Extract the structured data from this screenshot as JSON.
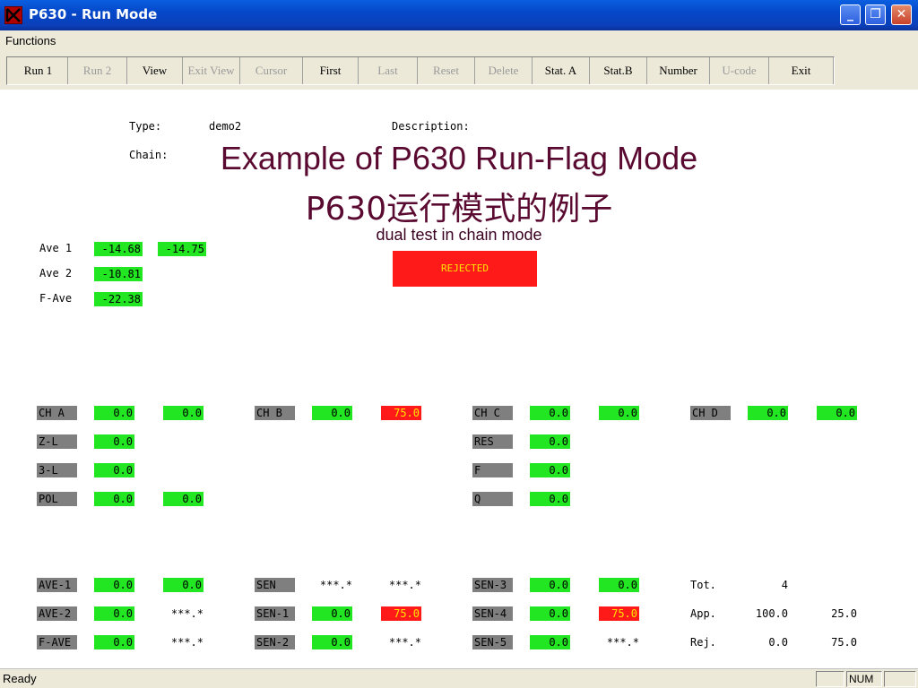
{
  "window": {
    "title": "P630 - Run Mode"
  },
  "menu": {
    "functions": "Functions"
  },
  "toolbar": {
    "buttons": [
      {
        "label": "Run 1",
        "enabled": true
      },
      {
        "label": "Run 2",
        "enabled": false
      },
      {
        "label": "View",
        "enabled": true
      },
      {
        "label": "Exit View",
        "enabled": false
      },
      {
        "label": "Cursor",
        "enabled": false
      },
      {
        "label": "First",
        "enabled": true
      },
      {
        "label": "Last",
        "enabled": false
      },
      {
        "label": "Reset",
        "enabled": false
      },
      {
        "label": "Delete",
        "enabled": false
      },
      {
        "label": "Stat. A",
        "enabled": true
      },
      {
        "label": "Stat.B",
        "enabled": true
      },
      {
        "label": "Number",
        "enabled": true
      },
      {
        "label": "U-code",
        "enabled": false
      },
      {
        "label": "Exit",
        "enabled": true
      }
    ]
  },
  "header": {
    "type_label": "Type:",
    "type_value": "demo2",
    "description_label": "Description:",
    "chain_label": "Chain:"
  },
  "overlay": {
    "title_en": "Example of P630 Run-Flag Mode",
    "title_cn": "P630运行模式的例子",
    "subtitle": "dual test in chain mode"
  },
  "status_banner": "REJECTED",
  "averages": {
    "ave1_label": "Ave 1",
    "ave1_a": "-14.68",
    "ave1_b": "-14.75",
    "ave2_label": "Ave 2",
    "ave2_a": "-10.81",
    "fave_label": "F-Ave",
    "fave_a": "-22.38"
  },
  "channels": {
    "ch_a": "CH A",
    "ch_a_1": "0.0",
    "ch_a_2": "0.0",
    "ch_b": "CH B",
    "ch_b_1": "0.0",
    "ch_b_2": "75.0",
    "ch_c": "CH C",
    "ch_c_1": "0.0",
    "ch_c_2": "0.0",
    "ch_d": "CH D",
    "ch_d_1": "0.0",
    "ch_d_2": "0.0",
    "z_l": "Z-L",
    "z_l_1": "0.0",
    "res": "RES",
    "res_1": "0.0",
    "three_l": "3-L",
    "three_l_1": "0.0",
    "f": "F",
    "f_1": "0.0",
    "pol": "POL",
    "pol_1": "0.0",
    "pol_2": "0.0",
    "q": "Q",
    "q_1": "0.0"
  },
  "results": {
    "ave_1": "AVE-1",
    "ave_1_a": "0.0",
    "ave_1_b": "0.0",
    "sen": "SEN",
    "sen_a": "***.*",
    "sen_b": "***.*",
    "sen_3": "SEN-3",
    "sen_3_a": "0.0",
    "sen_3_b": "0.0",
    "tot_label": "Tot.",
    "tot_value": "4",
    "ave_2": "AVE-2",
    "ave_2_a": "0.0",
    "ave_2_b": "***.*",
    "sen_1": "SEN-1",
    "sen_1_a": "0.0",
    "sen_1_b": "75.0",
    "sen_4": "SEN-4",
    "sen_4_a": "0.0",
    "sen_4_b": "75.0",
    "app_label": "App.",
    "app_a": "100.0",
    "app_b": "25.0",
    "f_ave": "F-AVE",
    "f_ave_a": "0.0",
    "f_ave_b": "***.*",
    "sen_2": "SEN-2",
    "sen_2_a": "0.0",
    "sen_2_b": "***.*",
    "sen_5": "SEN-5",
    "sen_5_a": "0.0",
    "sen_5_b": "***.*",
    "rej_label": "Rej.",
    "rej_a": "0.0",
    "rej_b": "75.0"
  },
  "statusbar": {
    "text": "Ready",
    "num": "NUM"
  },
  "colors": {
    "pass": "#22e622",
    "fail": "#ff1a1a",
    "label": "#7f7f7f",
    "title": "#5a0a30"
  }
}
